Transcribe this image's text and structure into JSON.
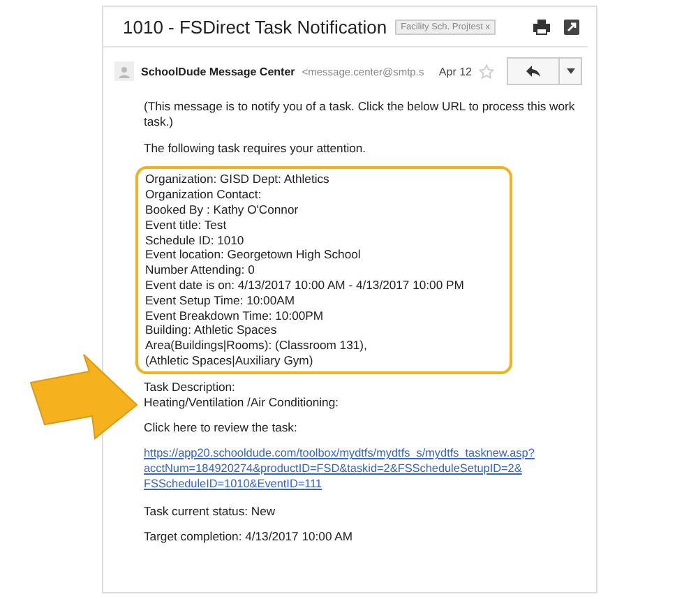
{
  "subject": "1010 - FSDirect Task Notification",
  "label_tag": "Facility Sch. Projtest  x",
  "sender": {
    "name": "SchoolDude Message Center",
    "address": "<message.center@smtp.s"
  },
  "date": "Apr 12",
  "starred": false,
  "intro": "(This message is to notify you of a task.  Click the below URL to process this work task.)",
  "lead": "The following task requires your attention.",
  "details": [
    "Organization: GISD Dept: Athletics",
    "Organization Contact:",
    "Booked By : Kathy O'Connor",
    "Event title: Test",
    "Schedule ID: 1010",
    "Event location: Georgetown High School",
    "Number Attending: 0",
    "Event date is on: 4/13/2017 10:00 AM - 4/13/2017 10:00 PM",
    "Event Setup Time: 10:00AM",
    "Event Breakdown Time: 10:00PM",
    "Building: Athletic Spaces",
    "Area(Buildings|Rooms): (Classroom 131),",
    "(Athletic Spaces|Auxiliary Gym)"
  ],
  "description": [
    "Task Description:",
    "Heating/Ventilation /Air Conditioning:"
  ],
  "review": "Click here to review the task:",
  "link": [
    "https://app20.schooldude.com/toolbox/mydtfs/mydtfs_s/mydtfs_tasknew.asp?",
    "acctNum=184920274&productID=FSD&taskid=2&FSScheduleSetupID=2&",
    "FSScheduleID=1010&EventID=111"
  ],
  "status": "Task current status: New",
  "target": "Target completion: 4/13/2017 10:00 AM"
}
